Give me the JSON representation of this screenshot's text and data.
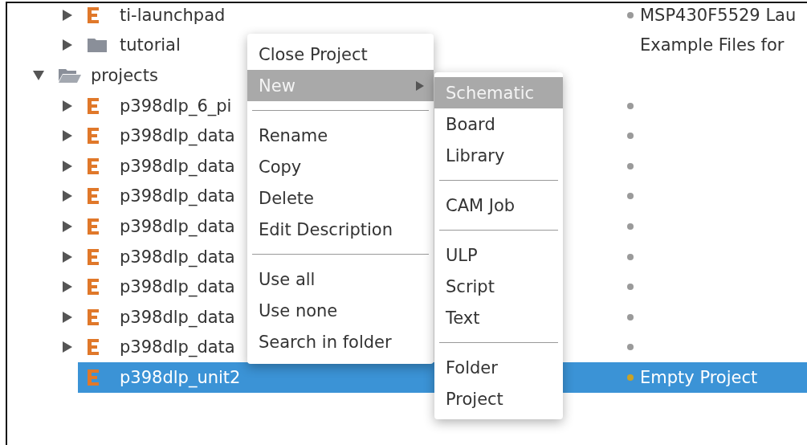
{
  "tree": [
    {
      "children": [
        {
          "name": "ti-launchpad",
          "kind": "project",
          "expanded": false,
          "selected": false,
          "color": "#9a9a9a",
          "description": "MSP430F5529 Lau"
        },
        {
          "name": "tutorial",
          "kind": "folder",
          "expanded": false,
          "selected": false,
          "description": "Example Files for"
        }
      ]
    },
    {
      "name": "projects",
      "kind": "folder",
      "expanded": true,
      "selected": false,
      "children": [
        {
          "name": "p398dlp_6_pi",
          "kind": "project",
          "expanded": false,
          "selected": false,
          "color": "#9a9a9a"
        },
        {
          "name": "p398dlp_data",
          "kind": "project",
          "expanded": false,
          "selected": false,
          "color": "#9a9a9a"
        },
        {
          "name": "p398dlp_data",
          "kind": "project",
          "expanded": false,
          "selected": false,
          "color": "#9a9a9a"
        },
        {
          "name": "p398dlp_data",
          "kind": "project",
          "expanded": false,
          "selected": false,
          "color": "#9a9a9a"
        },
        {
          "name": "p398dlp_data",
          "kind": "project",
          "expanded": false,
          "selected": false,
          "color": "#9a9a9a"
        },
        {
          "name": "p398dlp_data",
          "kind": "project",
          "expanded": false,
          "selected": false,
          "color": "#9a9a9a"
        },
        {
          "name": "p398dlp_data",
          "kind": "project",
          "expanded": false,
          "selected": false,
          "color": "#9a9a9a"
        },
        {
          "name": "p398dlp_data",
          "kind": "project",
          "expanded": false,
          "selected": false,
          "color": "#9a9a9a"
        },
        {
          "name": "p398dlp_data",
          "kind": "project",
          "expanded": false,
          "selected": false,
          "color": "#9a9a9a"
        },
        {
          "name": "p398dlp_unit2",
          "kind": "project",
          "selected": true,
          "color": "#c9a227",
          "description": "Empty Project"
        }
      ]
    }
  ],
  "context_menu": {
    "items": [
      {
        "kind": "item",
        "label": "Close Project",
        "selected": false
      },
      {
        "kind": "item",
        "label": "New",
        "selected": true,
        "submenu": true
      },
      {
        "kind": "separator"
      },
      {
        "kind": "item",
        "label": "Rename",
        "selected": false
      },
      {
        "kind": "item",
        "label": "Copy",
        "selected": false
      },
      {
        "kind": "item",
        "label": "Delete",
        "selected": false
      },
      {
        "kind": "item",
        "label": "Edit Description",
        "selected": false
      },
      {
        "kind": "separator"
      },
      {
        "kind": "item",
        "label": "Use all",
        "selected": false
      },
      {
        "kind": "item",
        "label": "Use none",
        "selected": false
      },
      {
        "kind": "item",
        "label": "Search in folder",
        "selected": false
      }
    ]
  },
  "submenu": {
    "items": [
      {
        "kind": "item",
        "label": "Schematic",
        "selected": true
      },
      {
        "kind": "item",
        "label": "Board",
        "selected": false
      },
      {
        "kind": "item",
        "label": "Library",
        "selected": false
      },
      {
        "kind": "separator"
      },
      {
        "kind": "item",
        "label": "CAM Job",
        "selected": false
      },
      {
        "kind": "separator"
      },
      {
        "kind": "item",
        "label": "ULP",
        "selected": false
      },
      {
        "kind": "item",
        "label": "Script",
        "selected": false
      },
      {
        "kind": "item",
        "label": "Text",
        "selected": false
      },
      {
        "kind": "separator"
      },
      {
        "kind": "item",
        "label": "Folder",
        "selected": false
      },
      {
        "kind": "item",
        "label": "Project",
        "selected": false
      }
    ]
  }
}
